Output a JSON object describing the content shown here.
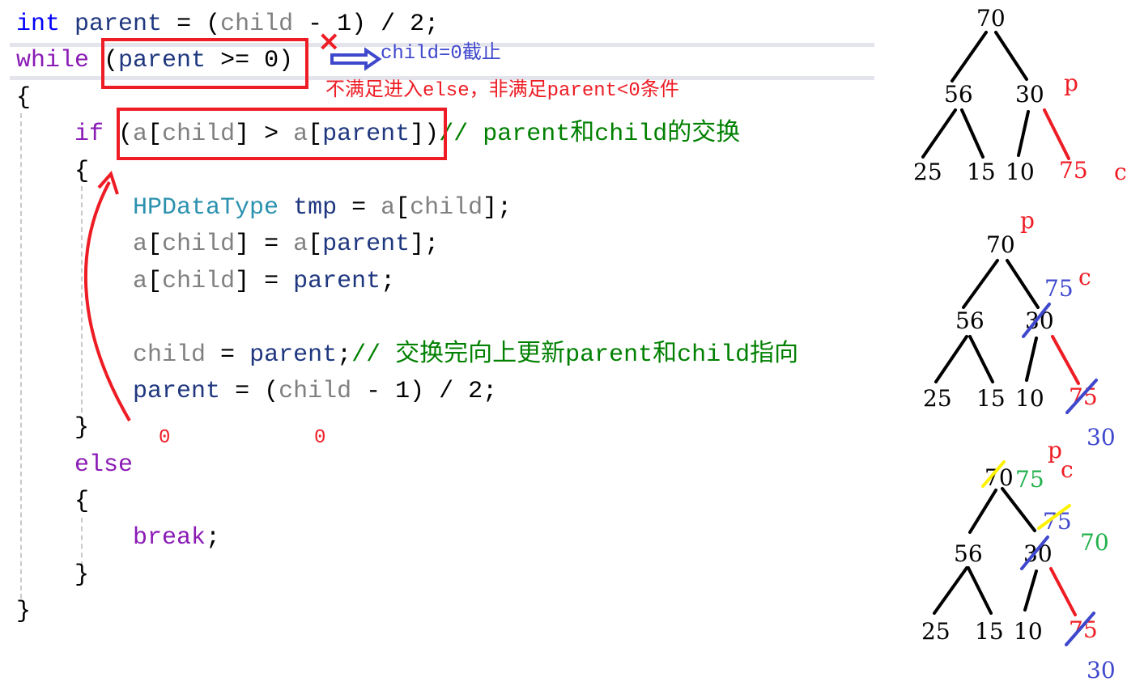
{
  "code_lines": [
    [
      [
        "int",
        "ty"
      ],
      [
        " ",
        "pu"
      ],
      [
        "parent",
        "pa"
      ],
      [
        " = (",
        "pu"
      ],
      [
        "child",
        "va"
      ],
      [
        " - 1) / 2;",
        "pu"
      ]
    ],
    [
      [
        "while",
        "kw"
      ],
      [
        " (",
        "pu"
      ],
      [
        "parent",
        "pa"
      ],
      [
        " >= 0)",
        "pu"
      ]
    ],
    [
      [
        "{",
        "pu"
      ]
    ],
    [
      [
        "    ",
        "pu"
      ],
      [
        "if",
        "kw"
      ],
      [
        " (",
        "pu"
      ],
      [
        "a",
        "va"
      ],
      [
        "[",
        "pu"
      ],
      [
        "child",
        "va"
      ],
      [
        "] > ",
        "pu"
      ],
      [
        "a",
        "va"
      ],
      [
        "[",
        "pu"
      ],
      [
        "parent",
        "pa"
      ],
      [
        "])",
        "pu"
      ],
      [
        "// parent和child的交换",
        "cm"
      ]
    ],
    [
      [
        "    {",
        "pu"
      ]
    ],
    [
      [
        "        ",
        "pu"
      ],
      [
        "HPDataType",
        "cl"
      ],
      [
        " ",
        "pu"
      ],
      [
        "tmp",
        "pa"
      ],
      [
        " = ",
        "pu"
      ],
      [
        "a",
        "va"
      ],
      [
        "[",
        "pu"
      ],
      [
        "child",
        "va"
      ],
      [
        "];",
        "pu"
      ]
    ],
    [
      [
        "        ",
        "pu"
      ],
      [
        "a",
        "va"
      ],
      [
        "[",
        "pu"
      ],
      [
        "child",
        "va"
      ],
      [
        "] = ",
        "pu"
      ],
      [
        "a",
        "va"
      ],
      [
        "[",
        "pu"
      ],
      [
        "parent",
        "pa"
      ],
      [
        "];",
        "pu"
      ]
    ],
    [
      [
        "        ",
        "pu"
      ],
      [
        "a",
        "va"
      ],
      [
        "[",
        "pu"
      ],
      [
        "child",
        "va"
      ],
      [
        "] = ",
        "pu"
      ],
      [
        "parent",
        "pa"
      ],
      [
        ";",
        "pu"
      ]
    ],
    [
      [
        "",
        "pu"
      ]
    ],
    [
      [
        "        ",
        "pu"
      ],
      [
        "child",
        "va"
      ],
      [
        " = ",
        "pu"
      ],
      [
        "parent",
        "pa"
      ],
      [
        ";",
        "pu"
      ],
      [
        "// 交换完向上更新parent和child指向",
        "cm"
      ]
    ],
    [
      [
        "        ",
        "pu"
      ],
      [
        "parent",
        "pa"
      ],
      [
        " = (",
        "pu"
      ],
      [
        "child",
        "va"
      ],
      [
        " - 1) / 2;",
        "pu"
      ]
    ],
    [
      [
        "    }",
        "pu"
      ]
    ],
    [
      [
        "    ",
        "pu"
      ],
      [
        "else",
        "kw"
      ]
    ],
    [
      [
        "    {",
        "pu"
      ]
    ],
    [
      [
        "        ",
        "pu"
      ],
      [
        "break",
        "kw"
      ],
      [
        ";",
        "pu"
      ]
    ],
    [
      [
        "    }",
        "pu"
      ]
    ],
    [
      [
        "}",
        "pu"
      ]
    ]
  ],
  "annotations": {
    "cross": "×",
    "child_zero": "child=0截止",
    "else_note": "不满足进入else，非满足parent<0条件",
    "zero_a": "0",
    "zero_b": "0"
  },
  "trees": [
    {
      "nodes": [
        "70",
        "56",
        "30",
        "25",
        "15",
        "10",
        "75"
      ],
      "labels": {
        "p": "p",
        "c": "c"
      }
    },
    {
      "nodes": [
        "70",
        "56",
        "30",
        "25",
        "15",
        "10",
        "75"
      ],
      "labels": {
        "p": "p",
        "c": "c",
        "new_parent": "75",
        "new_child": "30"
      }
    },
    {
      "nodes": [
        "70",
        "56",
        "30",
        "25",
        "15",
        "10",
        "75"
      ],
      "labels": {
        "p": "p",
        "c": "c",
        "root_new": "75",
        "mid_new": "75",
        "mid_newer": "70",
        "leaf_new": "30"
      }
    }
  ],
  "colors": {
    "red": "#ee1c24",
    "blue": "#3f48cc",
    "green": "#22b14c",
    "yellow": "#fff200"
  }
}
